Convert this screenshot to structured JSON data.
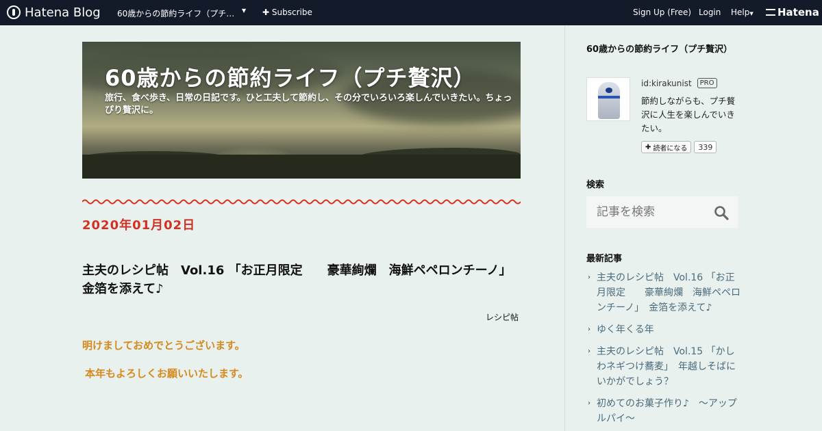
{
  "topbar": {
    "logo": "Hatena Blog",
    "blog_name": "60歳からの節約ライフ（プチ贅沢）",
    "subscribe": "Subscribe",
    "signup": "Sign Up (Free)",
    "login": "Login",
    "help": "Help",
    "hatena": "Hatena"
  },
  "header": {
    "title": "60歳からの節約ライフ（プチ贅沢）",
    "description": "旅行、食べ歩き、日常の日記です。ひと工夫して節約し、その分でいろいろ楽しんでいきたい。ちょっぴり贅沢に。"
  },
  "entry": {
    "date": "2020年01月02日",
    "title": "主夫のレシピ帖　Vol.16 「お正月限定 　豪華絢爛　海鮮ペペロンチーノ」　金箔を添えて♪",
    "category": "レシピ帖",
    "paragraph1": "明けましておめでとうございます。",
    "paragraph2": "本年もよろしくお願いいたします。"
  },
  "sidebar": {
    "profile_title": "60歳からの節約ライフ（プチ贅沢）",
    "user_id": "id:kirakunist",
    "badge": "PRO",
    "bio": "節約しながらも、プチ贅沢に人生を楽しんでいきたい。",
    "follow_label": "読者になる",
    "follow_count": "339",
    "search_heading": "検索",
    "search_placeholder": "記事を検索",
    "recent_heading": "最新記事",
    "recent": [
      "主夫のレシピ帖　Vol.16 「お正月限定 　豪華絢爛　海鮮ペペロンチーノ」　金箔を添えて♪",
      "ゆく年くる年",
      "主夫のレシピ帖　Vol.15 「かしわネギつけ蕎麦」　年越しそばにいかがでしょう？",
      "初めてのお菓子作り♪　～アップルパイ～"
    ]
  },
  "colors": {
    "topbar": "#131a2a",
    "page_bg": "#e9f1ee",
    "date": "#d23022",
    "greeting": "#d48a1e",
    "link": "#4a6a7d"
  }
}
